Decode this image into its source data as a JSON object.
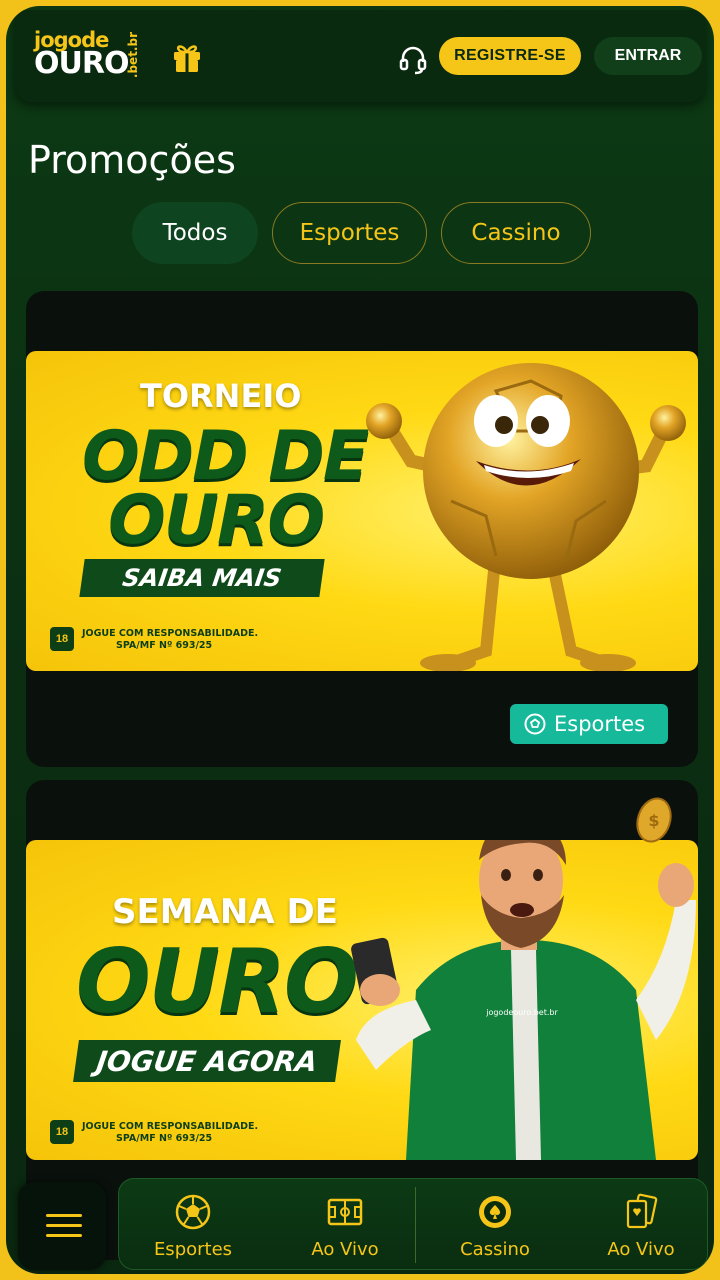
{
  "header": {
    "logo_line1": "jogode",
    "logo_line2": "OURO",
    "logo_suffix": ".bet.br",
    "register_label": "REGISTRE-SE",
    "login_label": "ENTRAR",
    "icons": [
      "gift-icon",
      "headset-icon"
    ]
  },
  "page": {
    "title": "Promoções"
  },
  "tabs": [
    {
      "label": "Todos",
      "active": true
    },
    {
      "label": "Esportes",
      "active": false
    },
    {
      "label": "Cassino",
      "active": false
    }
  ],
  "promos": [
    {
      "line1": "TORNEIO",
      "line2": "ODD DE",
      "line3": "OURO",
      "cta": "SAIBA MAIS",
      "age": "18",
      "responsibility": "JOGUE COM RESPONSABILIDADE.",
      "license": "SPA/MF Nº 693/25",
      "tag": "Esportes"
    },
    {
      "line1": "SEMANA DE",
      "line2": "OURO",
      "cta": "JOGUE AGORA",
      "age": "18",
      "responsibility": "JOGUE COM RESPONSABILIDADE.",
      "license": "SPA/MF Nº 693/25",
      "jacket_text": "jogodeouro.bet.br"
    }
  ],
  "bottom_nav": [
    {
      "label": "Esportes",
      "icon": "soccer-ball-icon"
    },
    {
      "label": "Ao Vivo",
      "icon": "field-icon"
    },
    {
      "label": "Cassino",
      "icon": "casino-chip-icon"
    },
    {
      "label": "Ao Vivo",
      "icon": "cards-icon"
    }
  ],
  "colors": {
    "accent": "#f5c518",
    "background": "#0b3012",
    "tag": "#17b99b"
  }
}
